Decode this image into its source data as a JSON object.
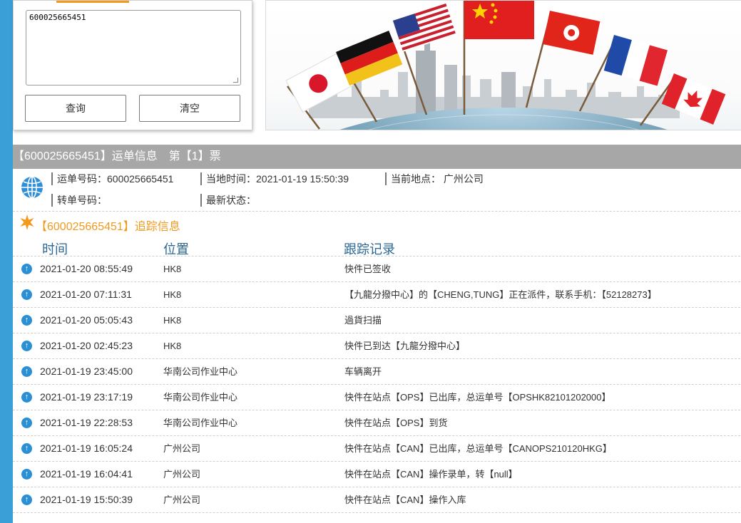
{
  "query": {
    "tracking_value": "600025665451",
    "search_label": "查询",
    "clear_label": "清空"
  },
  "waybill": {
    "title": "【600025665451】运单信息　第【1】票",
    "waybill_no": "运单号码：600025665451",
    "local_time": "当地时间：2021-01-19 15:50:39",
    "current_location": "当前地点： 广州公司",
    "transfer_no": "转单号码：",
    "latest_status": "最新状态："
  },
  "tracking": {
    "title": "【600025665451】追踪信息",
    "col_time": "时间",
    "col_location": "位置",
    "col_record": "跟踪记录",
    "rows": [
      {
        "time": "2021-01-20 08:55:49",
        "location": "HK8",
        "record": "快件已签收"
      },
      {
        "time": "2021-01-20 07:11:31",
        "location": "HK8",
        "record": "【九龍分撥中心】的【CHENG,TUNG】正在派件，联系手机：【52128273】"
      },
      {
        "time": "2021-01-20 05:05:43",
        "location": "HK8",
        "record": "過貨扫描"
      },
      {
        "time": "2021-01-20 02:45:23",
        "location": "HK8",
        "record": "快件已到达【九龍分撥中心】"
      },
      {
        "time": "2021-01-19 23:45:00",
        "location": "华南公司作业中心",
        "record": "车辆离开"
      },
      {
        "time": "2021-01-19 23:17:19",
        "location": "华南公司作业中心",
        "record": "快件在站点【OPS】已出库，总运单号【OPSHK82101202000】"
      },
      {
        "time": "2021-01-19 22:28:53",
        "location": "华南公司作业中心",
        "record": "快件在站点【OPS】到货"
      },
      {
        "time": "2021-01-19 16:05:24",
        "location": "广州公司",
        "record": "快件在站点【CAN】已出库，总运单号【CANOPS210120HKG】"
      },
      {
        "time": "2021-01-19 16:04:41",
        "location": "广州公司",
        "record": "快件在站点【CAN】操作录单，转【null】"
      },
      {
        "time": "2021-01-19 15:50:39",
        "location": "广州公司",
        "record": "快件在站点【CAN】操作入库"
      }
    ]
  },
  "icons": {
    "globe": "globe-icon",
    "star": "star-icon",
    "row_status": "arrow-up-circle-icon"
  },
  "colors": {
    "accent_orange": "#f39a1e",
    "sidebar_blue": "#3a9fd6",
    "title_gray": "#a7a7a7",
    "header_blue": "#2a6794"
  }
}
